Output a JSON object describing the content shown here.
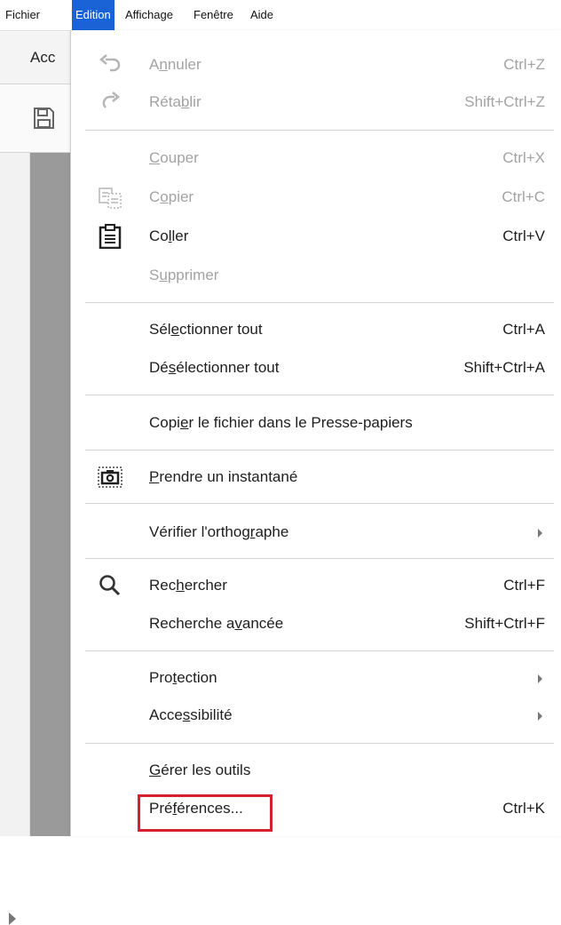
{
  "menubar": {
    "items": [
      "Fichier",
      "Edition",
      "Affichage",
      "Fenêtre",
      "Aide"
    ],
    "active": "Edition",
    "active_color": "#1a63d6"
  },
  "background": {
    "tab_label": "Acc",
    "save_icon": "save-icon",
    "expand_icon": "chevron-right-icon"
  },
  "menu": {
    "items": [
      {
        "label": "Annuler",
        "mnemonic": "n",
        "shortcut": "Ctrl+Z",
        "enabled": false,
        "icon": "undo-icon"
      },
      {
        "label": "Rétablir",
        "mnemonic": "b",
        "shortcut": "Shift+Ctrl+Z",
        "enabled": false,
        "icon": "redo-icon"
      },
      {
        "label": "Couper",
        "mnemonic": "C",
        "shortcut": "Ctrl+X",
        "enabled": false
      },
      {
        "label": "Copier",
        "mnemonic": "o",
        "shortcut": "Ctrl+C",
        "enabled": false,
        "icon": "copy-icon"
      },
      {
        "label": "Coller",
        "mnemonic": "l",
        "shortcut": "Ctrl+V",
        "enabled": true,
        "icon": "paste-icon"
      },
      {
        "label": "Supprimer",
        "mnemonic": "u",
        "shortcut": "",
        "enabled": false
      },
      {
        "label": "Sélectionner tout",
        "mnemonic": "e",
        "shortcut": "Ctrl+A",
        "enabled": true
      },
      {
        "label": "Désélectionner tout",
        "mnemonic": "s",
        "shortcut": "Shift+Ctrl+A",
        "enabled": true
      },
      {
        "label": "Copier le fichier dans le Presse-papiers",
        "mnemonic": "i",
        "shortcut": "",
        "enabled": true
      },
      {
        "label": "Prendre un instantané",
        "mnemonic": "P",
        "shortcut": "",
        "enabled": true,
        "icon": "snapshot-camera-icon"
      },
      {
        "label": "Vérifier l'orthographe",
        "mnemonic": "r",
        "shortcut": "",
        "enabled": true,
        "submenu": true
      },
      {
        "label": "Rechercher",
        "mnemonic": "h",
        "shortcut": "Ctrl+F",
        "enabled": true,
        "icon": "search-icon"
      },
      {
        "label": "Recherche avancée",
        "mnemonic": "v",
        "shortcut": "Shift+Ctrl+F",
        "enabled": true
      },
      {
        "label": "Protection",
        "mnemonic": "t",
        "shortcut": "",
        "enabled": true,
        "submenu": true
      },
      {
        "label": "Accessibilité",
        "mnemonic": "s",
        "shortcut": "",
        "enabled": true,
        "submenu": true
      },
      {
        "label": "Gérer les outils",
        "mnemonic": "G",
        "shortcut": "",
        "enabled": true
      },
      {
        "label": "Préférences...",
        "mnemonic": "f",
        "shortcut": "Ctrl+K",
        "enabled": true,
        "highlighted": true
      }
    ],
    "highlight_color": "#d6202b"
  }
}
